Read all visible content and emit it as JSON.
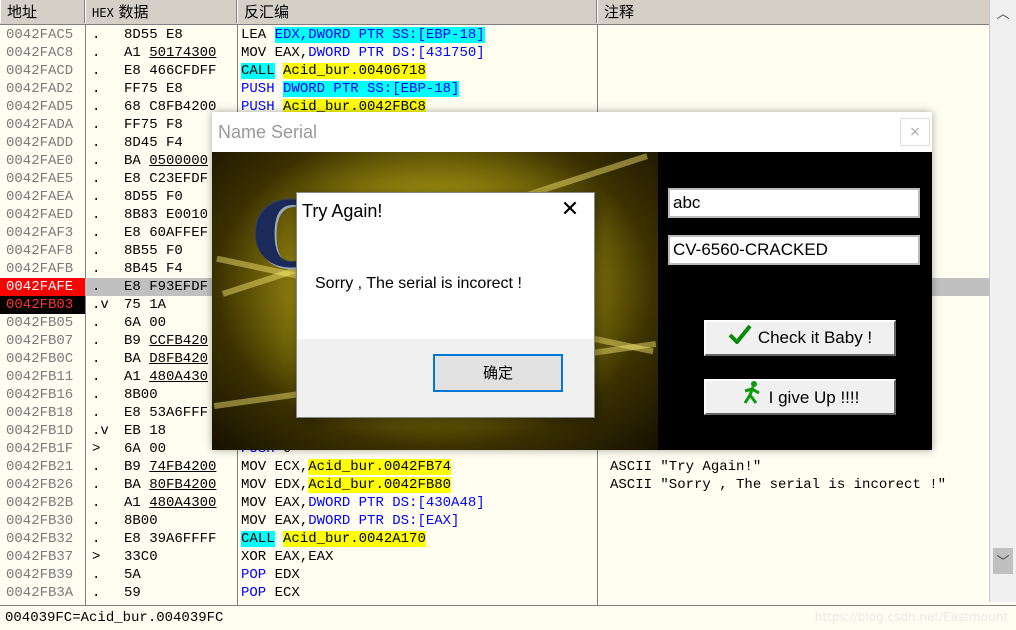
{
  "debugger": {
    "headers": {
      "address": "地址",
      "hex_prefix": "HEX",
      "hex": "数据",
      "disasm": "反汇编",
      "comment": "注释"
    },
    "status_text": "004039FC=Acid_bur.004039FC",
    "watermark": "https://blog.csdn.net/Eastmount",
    "rows": [
      {
        "a": "0042FAC5",
        "m": ".",
        "h": "8D55 E8",
        "d": "LEA EDX,DWORD PTR SS:[EBP-18]",
        "c": ""
      },
      {
        "a": "0042FAC8",
        "m": ".",
        "h": "A1 50174300",
        "d": "MOV EAX,DWORD PTR DS:[431750]",
        "c": ""
      },
      {
        "a": "0042FACD",
        "m": ".",
        "h": "E8 466CFDFF",
        "d": "CALL Acid_bur.00406718",
        "c": ""
      },
      {
        "a": "0042FAD2",
        "m": ".",
        "h": "FF75 E8",
        "d": "PUSH DWORD PTR SS:[EBP-18]",
        "c": ""
      },
      {
        "a": "0042FAD5",
        "m": ".",
        "h": "68 C8FB4200",
        "d": "PUSH Acid_bur.0042FBC8",
        "c": ""
      },
      {
        "a": "0042FADA",
        "m": ".",
        "h": "FF75 F8",
        "d": "",
        "c": ""
      },
      {
        "a": "0042FADD",
        "m": ".",
        "h": "8D45 F4",
        "d": "",
        "c": ""
      },
      {
        "a": "0042FAE0",
        "m": ".",
        "h": "BA 0500000",
        "d": "",
        "c": ""
      },
      {
        "a": "0042FAE5",
        "m": ".",
        "h": "E8 C23EFDF",
        "d": "",
        "c": ""
      },
      {
        "a": "0042FAEA",
        "m": ".",
        "h": "8D55 F0",
        "d": "",
        "c": ""
      },
      {
        "a": "0042FAED",
        "m": ".",
        "h": "8B83 E0010",
        "d": "",
        "c": ""
      },
      {
        "a": "0042FAF3",
        "m": ".",
        "h": "E8 60AFFEF",
        "d": "",
        "c": ""
      },
      {
        "a": "0042FAF8",
        "m": ".",
        "h": "8B55 F0",
        "d": "",
        "c": ""
      },
      {
        "a": "0042FAFB",
        "m": ".",
        "h": "8B45 F4",
        "d": "",
        "c": ""
      },
      {
        "a": "0042FAFE",
        "m": ".",
        "h": "E8 F93EFDF",
        "d": "",
        "c": ""
      },
      {
        "a": "0042FB03",
        "m": ".v",
        "h": "75 1A",
        "d": "",
        "c": ""
      },
      {
        "a": "0042FB05",
        "m": ".",
        "h": "6A 00",
        "d": "",
        "c": ""
      },
      {
        "a": "0042FB07",
        "m": ".",
        "h": "B9 CCFB420",
        "d": "",
        "c": ""
      },
      {
        "a": "0042FB0C",
        "m": ".",
        "h": "BA D8FB420",
        "d": "",
        "c": ""
      },
      {
        "a": "0042FB11",
        "m": ".",
        "h": "A1 480A430",
        "d": "",
        "c": ""
      },
      {
        "a": "0042FB16",
        "m": ".",
        "h": "8B00",
        "d": "",
        "c": ""
      },
      {
        "a": "0042FB18",
        "m": ".",
        "h": "E8 53A6FFF",
        "d": "",
        "c": ""
      },
      {
        "a": "0042FB1D",
        "m": ".v",
        "h": "EB 18",
        "d": "",
        "c": ""
      },
      {
        "a": "0042FB1F",
        "m": ">",
        "h": "6A 00",
        "d": "PUSH 0",
        "c": ""
      },
      {
        "a": "0042FB21",
        "m": ".",
        "h": "B9 74FB4200",
        "d": "MOV ECX,Acid_bur.0042FB74",
        "c": "ASCII \"Try Again!\""
      },
      {
        "a": "0042FB26",
        "m": ".",
        "h": "BA 80FB4200",
        "d": "MOV EDX,Acid_bur.0042FB80",
        "c": "ASCII \"Sorry , The serial is incorect !\""
      },
      {
        "a": "0042FB2B",
        "m": ".",
        "h": "A1 480A4300",
        "d": "MOV EAX,DWORD PTR DS:[430A48]",
        "c": ""
      },
      {
        "a": "0042FB30",
        "m": ".",
        "h": "8B00",
        "d": "MOV EAX,DWORD PTR DS:[EAX]",
        "c": ""
      },
      {
        "a": "0042FB32",
        "m": ".",
        "h": "E8 39A6FFFF",
        "d": "CALL Acid_bur.0042A170",
        "c": ""
      },
      {
        "a": "0042FB37",
        "m": ">",
        "h": "33C0",
        "d": "XOR EAX,EAX",
        "c": ""
      },
      {
        "a": "0042FB39",
        "m": ".",
        "h": "5A",
        "d": "POP EDX",
        "c": ""
      },
      {
        "a": "0042FB3A",
        "m": ".",
        "h": "59",
        "d": "POP ECX",
        "c": ""
      }
    ]
  },
  "name_serial": {
    "title": "Name Serial",
    "close_glyph": "×",
    "logo_text": "C",
    "name_value": "abc",
    "serial_value": "CV-6560-CRACKED",
    "check_button": "Check it Baby !",
    "giveup_button": "I give Up !!!!"
  },
  "try_again": {
    "title": "Try Again!",
    "close_glyph": "✕",
    "message": "Sorry , The serial is incorect !",
    "ok_button": "确定"
  },
  "icons": [
    "checkmark-icon",
    "running-man-icon",
    "close-icon",
    "scroll-up-icon",
    "scroll-down-icon"
  ]
}
